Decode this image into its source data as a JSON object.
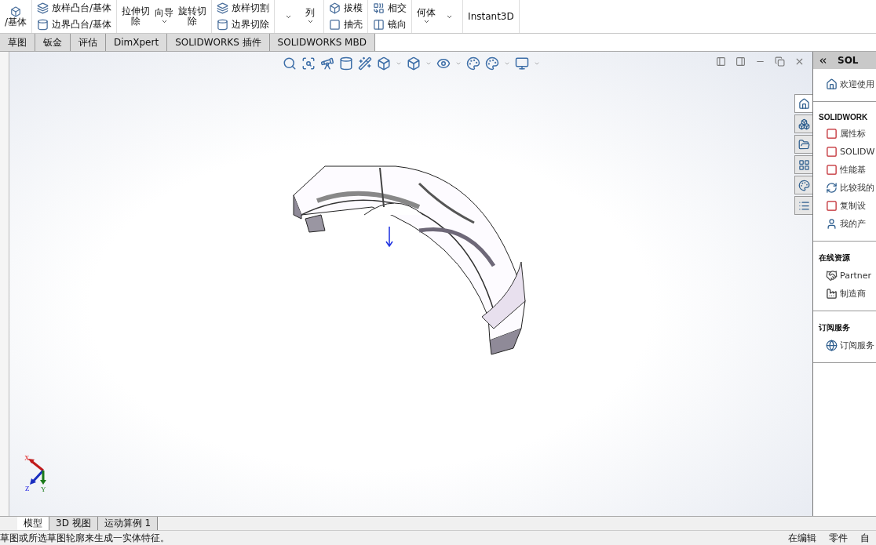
{
  "ribbon": {
    "groups": [
      {
        "kind": "large",
        "items": [
          {
            "lines": [
              "/基体"
            ],
            "caret": false
          }
        ]
      },
      {
        "kind": "small",
        "items": [
          {
            "label": "放样凸台/基体"
          },
          {
            "label": "边界凸台/基体"
          }
        ]
      },
      {
        "kind": "large",
        "items": [
          {
            "lines": [
              "拉伸切",
              "除"
            ],
            "caret": false
          },
          {
            "lines": [
              "向导"
            ],
            "caret": true
          },
          {
            "lines": [
              "旋转切",
              "除"
            ],
            "caret": false
          }
        ]
      },
      {
        "kind": "small",
        "items": [
          {
            "label": "放样切割"
          },
          {
            "label": "边界切除"
          }
        ]
      },
      {
        "kind": "large",
        "items": [
          {
            "caret": true
          },
          {
            "lines": [
              "列"
            ],
            "caret": true
          }
        ]
      },
      {
        "kind": "small",
        "items": [
          {
            "label": "拔模"
          },
          {
            "label": "抽壳"
          }
        ]
      },
      {
        "kind": "small",
        "items": [
          {
            "label": "相交"
          },
          {
            "label": "镜向"
          }
        ]
      },
      {
        "kind": "large",
        "items": [
          {
            "lines": [
              "何体"
            ],
            "caret": true
          },
          {
            "caret": true
          }
        ]
      },
      {
        "kind": "large",
        "items": [
          {
            "lines": [
              "Instant3D"
            ],
            "caret": false
          }
        ]
      }
    ]
  },
  "tabs": [
    {
      "label": "草图",
      "selected": false
    },
    {
      "label": "钣金",
      "selected": false
    },
    {
      "label": "评估",
      "selected": false
    },
    {
      "label": "DimXpert",
      "selected": false
    },
    {
      "label": "SOLIDWORKS 插件",
      "selected": false
    },
    {
      "label": "SOLIDWORKS MBD",
      "selected": false
    }
  ],
  "side_tabs": [
    {
      "selected": true
    },
    {
      "selected": false
    },
    {
      "selected": false
    },
    {
      "selected": false
    },
    {
      "selected": false
    },
    {
      "selected": false
    }
  ],
  "task_pane": {
    "title": "SOL",
    "sections": [
      {
        "items": [
          {
            "label": "欢迎使用"
          }
        ]
      },
      {
        "heading": "SOLIDWORK",
        "items": [
          {
            "label": "属性标"
          },
          {
            "label": "SOLIDW"
          },
          {
            "label": "性能基"
          },
          {
            "label": "比较我的"
          },
          {
            "label": "复制设"
          },
          {
            "label": "我的产"
          }
        ]
      },
      {
        "heading": "在线资源",
        "items": [
          {
            "label": "Partner"
          },
          {
            "label": "制造商"
          }
        ]
      },
      {
        "heading": "订阅服务",
        "items": [
          {
            "label": "订阅服务"
          }
        ]
      }
    ]
  },
  "triad": {
    "x": "X",
    "y": "Y",
    "z": "Z"
  },
  "bottom_tabs": [
    {
      "label": "模型",
      "selected": true
    },
    {
      "label": "3D 视图",
      "selected": false
    },
    {
      "label": "运动算例 1",
      "selected": false
    }
  ],
  "status_bar": {
    "message": "草图或所选草图轮廓来生成一实体特征。",
    "mode": "在编辑",
    "document": "零件",
    "extra": "自"
  }
}
